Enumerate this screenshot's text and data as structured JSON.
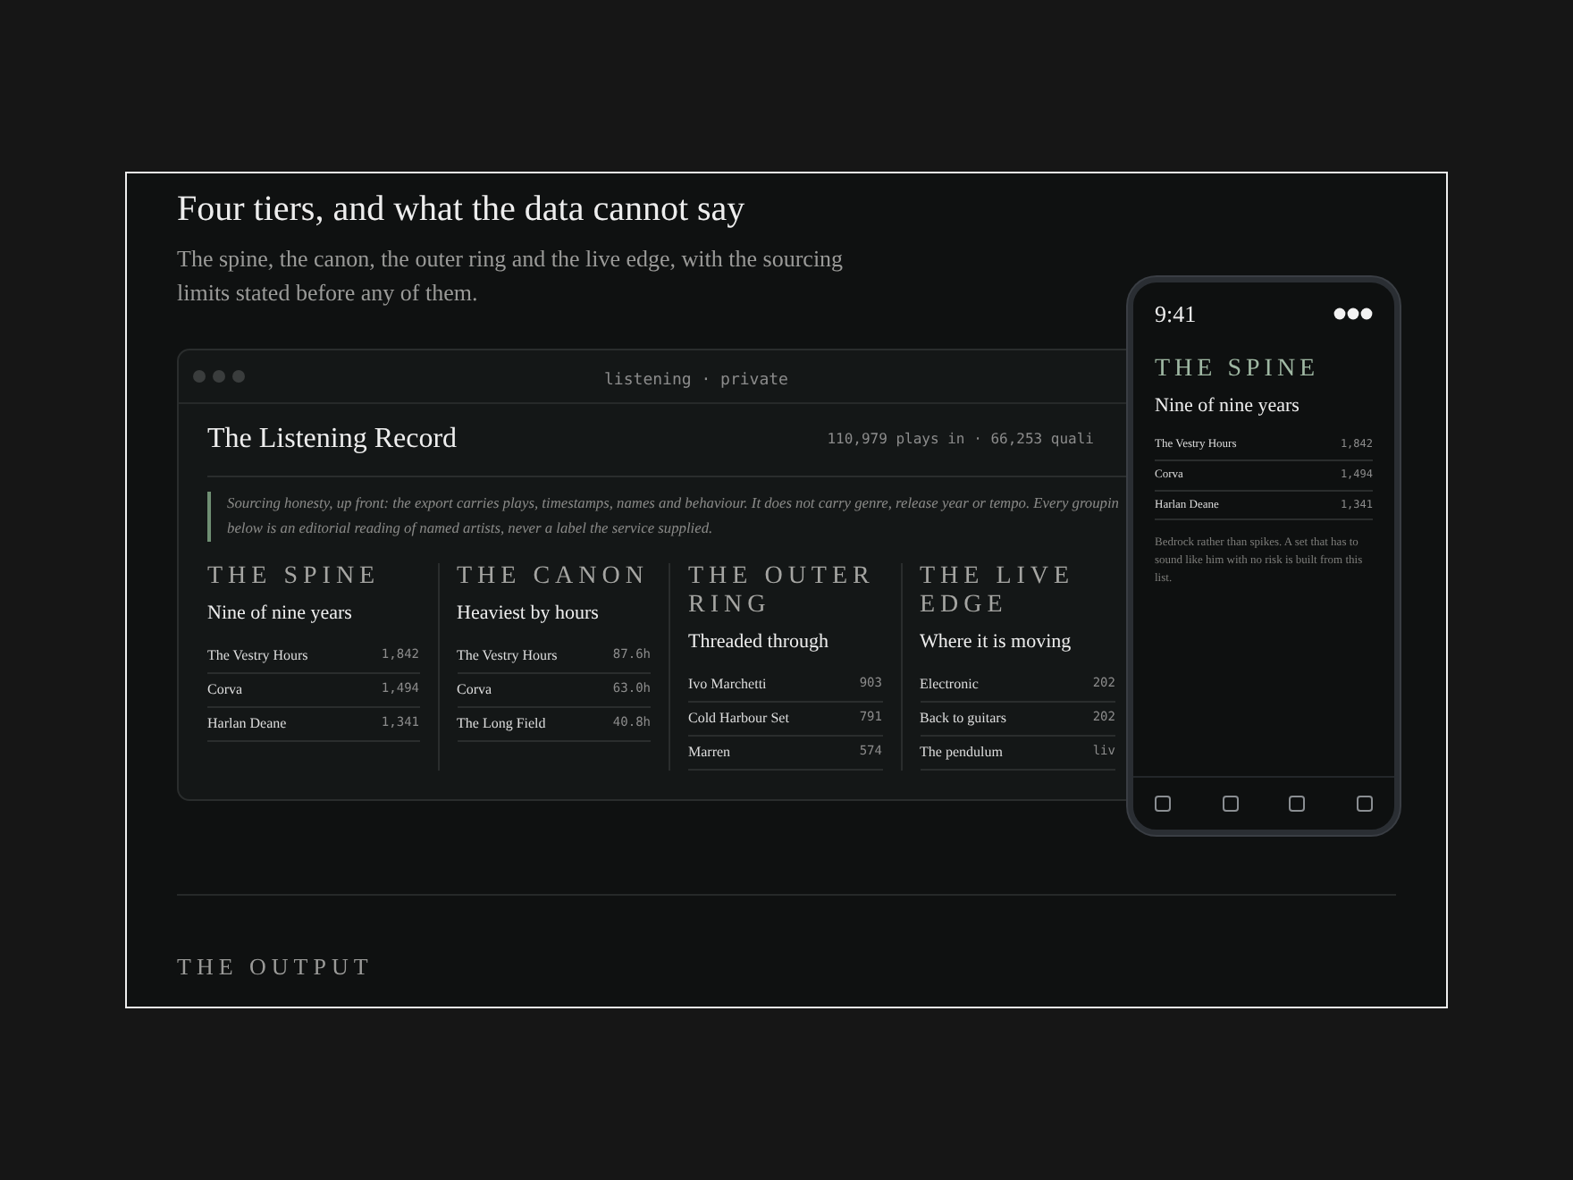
{
  "section": {
    "title": "Four tiers, and what the data cannot say",
    "lede": "The spine, the canon, the outer ring and the live edge, with the sourcing limits stated before any of them."
  },
  "window": {
    "title": "listening · private",
    "heading": "The Listening Record",
    "meta": "110,979 plays in · 66,253 quali",
    "note": "Sourcing honesty, up front: the export carries plays, timestamps, names and behaviour. It does not carry genre, release year or tempo. Every groupin below is an editorial reading of named artists, never a label the service supplied."
  },
  "tiers": [
    {
      "label": "THE SPINE",
      "subtitle": "Nine of nine years",
      "rows": [
        {
          "name": "The Vestry Hours",
          "value": "1,842"
        },
        {
          "name": "Corva",
          "value": "1,494"
        },
        {
          "name": "Harlan Deane",
          "value": "1,341"
        }
      ]
    },
    {
      "label": "THE CANON",
      "subtitle": "Heaviest by hours",
      "rows": [
        {
          "name": "The Vestry Hours",
          "value": "87.6h"
        },
        {
          "name": "Corva",
          "value": "63.0h"
        },
        {
          "name": "The Long Field",
          "value": "40.8h"
        }
      ]
    },
    {
      "label": "THE OUTER RING",
      "subtitle": "Threaded through",
      "rows": [
        {
          "name": "Ivo Marchetti",
          "value": "903"
        },
        {
          "name": "Cold Harbour Set",
          "value": "791"
        },
        {
          "name": "Marren",
          "value": "574"
        }
      ]
    },
    {
      "label": "THE LIVE EDGE",
      "subtitle": "Where it is moving",
      "rows": [
        {
          "name": "Electronic",
          "value": "202"
        },
        {
          "name": "Back to guitars",
          "value": "202"
        },
        {
          "name": "The pendulum",
          "value": "liv"
        }
      ]
    }
  ],
  "phone": {
    "time": "9:41",
    "label": "THE SPINE",
    "subtitle": "Nine of nine years",
    "rows": [
      {
        "name": "The Vestry Hours",
        "value": "1,842"
      },
      {
        "name": "Corva",
        "value": "1,494"
      },
      {
        "name": "Harlan Deane",
        "value": "1,341"
      }
    ],
    "note": "Bedrock rather than spikes. A set that has to sound like him with no risk is built from this list."
  },
  "next_section": {
    "label": "THE OUTPUT"
  }
}
